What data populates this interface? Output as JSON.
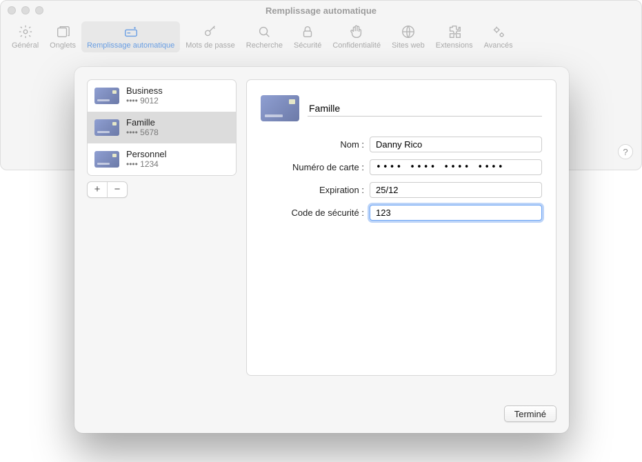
{
  "window": {
    "title": "Remplissage automatique"
  },
  "toolbar": {
    "items": [
      {
        "label": "Général"
      },
      {
        "label": "Onglets"
      },
      {
        "label": "Remplissage automatique"
      },
      {
        "label": "Mots de passe"
      },
      {
        "label": "Recherche"
      },
      {
        "label": "Sécurité"
      },
      {
        "label": "Confidentialité"
      },
      {
        "label": "Sites web"
      },
      {
        "label": "Extensions"
      },
      {
        "label": "Avancés"
      }
    ]
  },
  "help_glyph": "?",
  "sidebar": {
    "cards": [
      {
        "title": "Business",
        "sub": "•••• 9012"
      },
      {
        "title": "Famille",
        "sub": "•••• 5678"
      },
      {
        "title": "Personnel",
        "sub": "•••• 1234"
      }
    ],
    "selected_index": 1,
    "add_glyph": "+",
    "remove_glyph": "−"
  },
  "detail": {
    "description_value": "Famille",
    "fields": {
      "name": {
        "label": "Nom :",
        "value": "Danny Rico"
      },
      "number": {
        "label": "Numéro de carte :",
        "value": "•••• •••• •••• ••••"
      },
      "expiration": {
        "label": "Expiration :",
        "value": "25/12"
      },
      "cvc": {
        "label": "Code de sécurité :",
        "value": "123"
      }
    }
  },
  "footer": {
    "done_label": "Terminé"
  }
}
